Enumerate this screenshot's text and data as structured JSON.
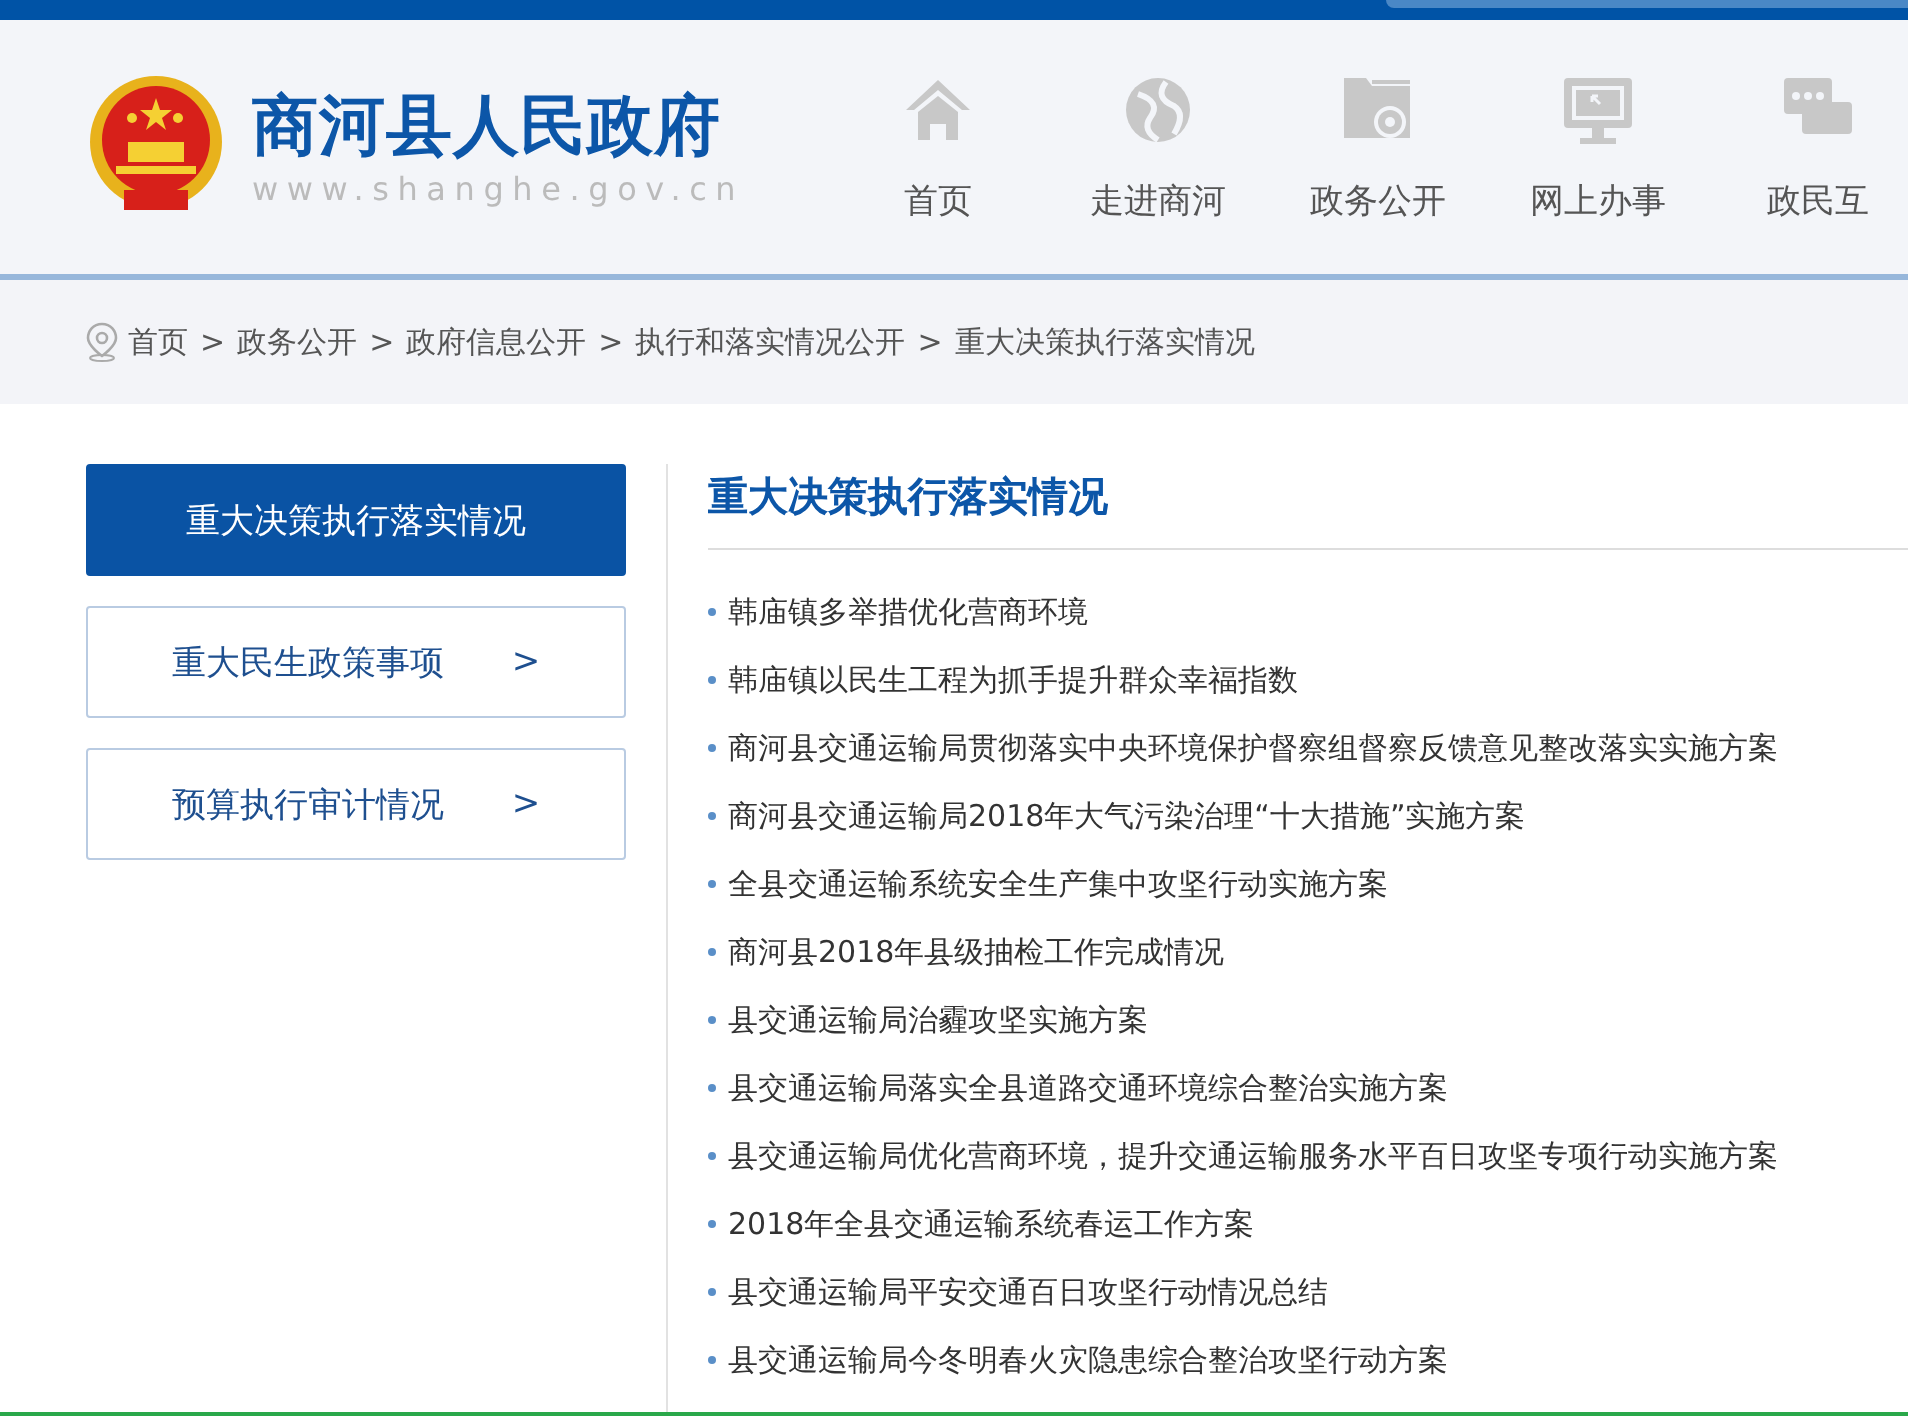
{
  "header": {
    "site_title": "商河县人民政府",
    "site_url": "www.shanghe.gov.cn"
  },
  "nav": [
    {
      "label": "首页",
      "kind": "home"
    },
    {
      "label": "走进商河",
      "kind": "globe"
    },
    {
      "label": "政务公开",
      "kind": "folder"
    },
    {
      "label": "网上办事",
      "kind": "monitor"
    },
    {
      "label": "政民互",
      "kind": "chat"
    }
  ],
  "breadcrumb": [
    "首页",
    "政务公开",
    "政府信息公开",
    "执行和落实情况公开",
    "重大决策执行落实情况"
  ],
  "breadcrumb_separator": ">",
  "sidebar": {
    "items": [
      {
        "label": "重大决策执行落实情况",
        "selected": true
      },
      {
        "label": "重大民生政策事项",
        "selected": false,
        "arrow": ">"
      },
      {
        "label": "预算执行审计情况",
        "selected": false,
        "arrow": ">"
      }
    ]
  },
  "content": {
    "title": "重大决策执行落实情况",
    "articles": [
      "韩庙镇多举措优化营商环境",
      "韩庙镇以民生工程为抓手提升群众幸福指数",
      "商河县交通运输局贯彻落实中央环境保护督察组督察反馈意见整改落实实施方案",
      "商河县交通运输局2018年大气污染治理“十大措施”实施方案",
      "全县交通运输系统安全生产集中攻坚行动实施方案",
      "商河县2018年县级抽检工作完成情况",
      "县交通运输局治霾攻坚实施方案",
      "县交通运输局落实全县道路交通环境综合整治实施方案",
      "县交通运输局优化营商环境，提升交通运输服务水平百日攻坚专项行动实施方案",
      "2018年全县交通运输系统春运工作方案",
      "县交通运输局平安交通百日攻坚行动情况总结",
      "县交通运输局今冬明春火灾隐患综合整治攻坚行动方案"
    ]
  }
}
